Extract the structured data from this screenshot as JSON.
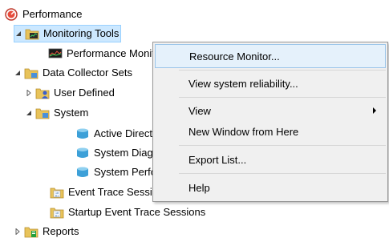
{
  "tree": {
    "root": {
      "label": "Performance",
      "icon": "performance-icon"
    },
    "monitoring_tools": {
      "label": "Monitoring Tools",
      "icon": "folder-chart-icon",
      "expanded": true,
      "selected": true
    },
    "performance_monitor": {
      "label": "Performance Monitor",
      "icon": "monitor-graph-icon"
    },
    "data_collector_sets": {
      "label": "Data Collector Sets",
      "icon": "folder-icon",
      "expanded": true
    },
    "user_defined": {
      "label": "User Defined",
      "icon": "folder-user-icon",
      "expanded": false
    },
    "system": {
      "label": "System",
      "icon": "folder-icon",
      "expanded": true
    },
    "active_directory": {
      "label": "Active Directory Diagnostics",
      "icon": "collector-set-icon"
    },
    "system_diagnostics": {
      "label": "System Diagnostics",
      "icon": "collector-set-icon"
    },
    "system_performance": {
      "label": "System Performance",
      "icon": "collector-set-icon"
    },
    "event_trace_sessions": {
      "label": "Event Trace Sessions",
      "icon": "binary-folder-icon"
    },
    "startup_event_trace": {
      "label": "Startup Event Trace Sessions",
      "icon": "binary-folder-icon"
    },
    "reports": {
      "label": "Reports",
      "icon": "folder-report-icon",
      "expanded": false
    }
  },
  "context_menu": {
    "items": [
      {
        "label": "Resource Monitor...",
        "highlighted": true
      },
      {
        "label": "View system reliability..."
      },
      {
        "label": "View",
        "has_submenu": true
      },
      {
        "label": "New Window from Here"
      },
      {
        "label": "Export List..."
      },
      {
        "label": "Help"
      }
    ]
  },
  "colors": {
    "selection": "#cce8ff",
    "menu_background": "#f0f0f0",
    "menu_highlight": "#e5f1fb",
    "folder_yellow": "#e8c35a",
    "accent_green": "#22a03c"
  }
}
